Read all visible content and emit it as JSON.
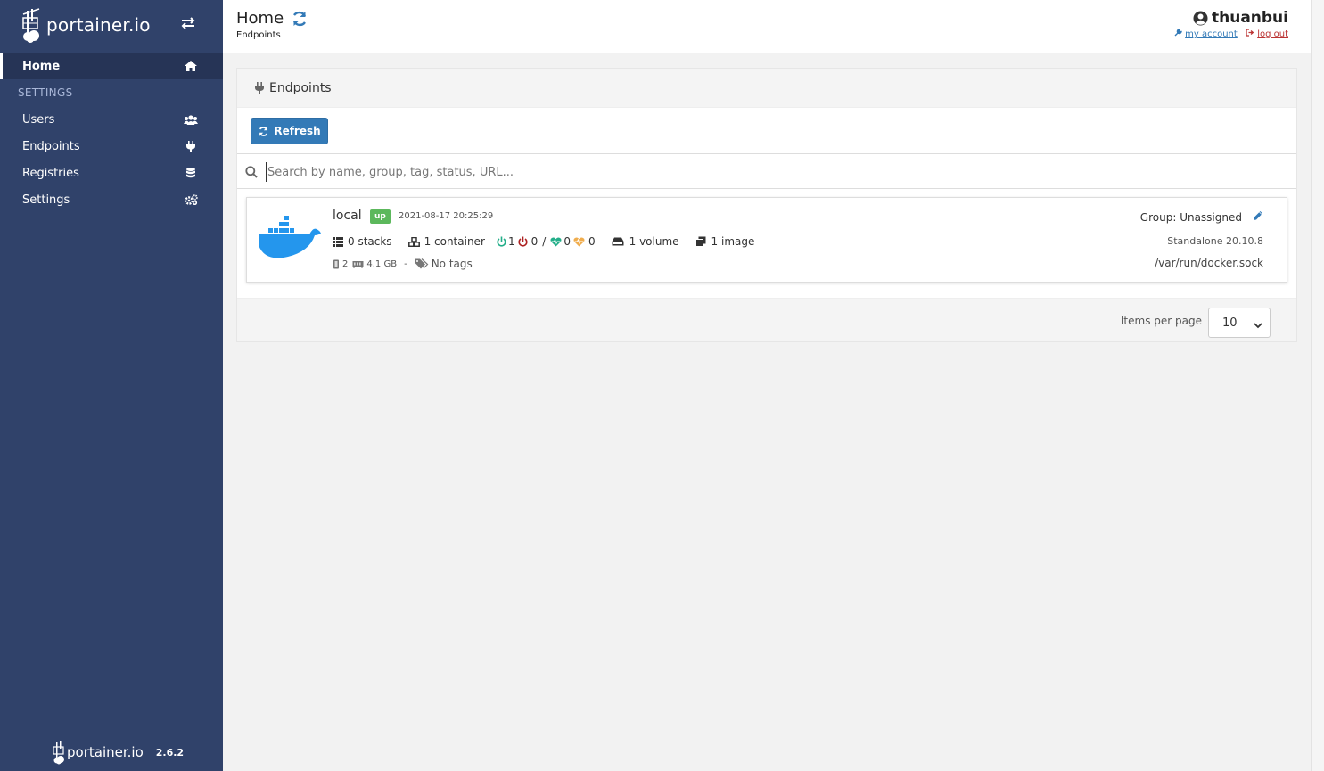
{
  "app": {
    "brand": "portainer.io",
    "version": "2.6.2"
  },
  "sidebar": {
    "home": "Home",
    "section_heading": "SETTINGS",
    "items": [
      {
        "label": "Users",
        "icon": "users-icon"
      },
      {
        "label": "Endpoints",
        "icon": "plug-icon"
      },
      {
        "label": "Registries",
        "icon": "database-icon"
      },
      {
        "label": "Settings",
        "icon": "cogs-icon"
      }
    ]
  },
  "header": {
    "title": "Home",
    "breadcrumb": "Endpoints",
    "username": "thuanbui",
    "my_account": "my account",
    "log_out": "log out"
  },
  "widget": {
    "title": "Endpoints",
    "refresh_button": "Refresh",
    "search_placeholder": "Search by name, group, tag, status, URL..."
  },
  "endpoint": {
    "name": "local",
    "status": "up",
    "timestamp": "2021-08-17 20:25:29",
    "stacks": "0 stacks",
    "containers": "1 container -",
    "running": "1",
    "stopped": "0",
    "sep": "/",
    "healthy": "0",
    "unhealthy": "0",
    "volumes": "1 volume",
    "images": "1 image",
    "cpu": "2",
    "memory": "4.1 GB",
    "dash": "-",
    "tags": "No tags",
    "group": "Group: Unassigned",
    "engine": "Standalone 20.10.8",
    "url": "/var/run/docker.sock"
  },
  "pagination": {
    "label": "Items per page",
    "value": "10"
  },
  "colors": {
    "sidebar": "#30426a",
    "primary": "#337ab7",
    "status_up": "#5cb85c",
    "running": "#23ae89",
    "stopped": "#ae2323",
    "unhealthy": "#f0ad4e"
  }
}
